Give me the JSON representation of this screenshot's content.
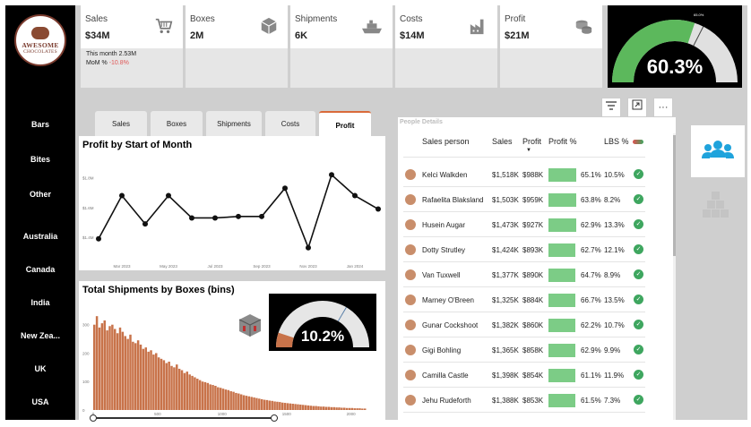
{
  "logo": {
    "line1": "AWESOME",
    "line2": "CHOCOLATES"
  },
  "nav": [
    "Bars",
    "Bites",
    "Other",
    "Australia",
    "Canada",
    "India",
    "New Zea...",
    "UK",
    "USA"
  ],
  "kpis": [
    {
      "label": "Sales",
      "value": "$34M",
      "icon": "cart-icon"
    },
    {
      "label": "Boxes",
      "value": "2M",
      "icon": "box-icon"
    },
    {
      "label": "Shipments",
      "value": "6K",
      "icon": "ship-icon"
    },
    {
      "label": "Costs",
      "value": "$14M",
      "icon": "factory-icon"
    },
    {
      "label": "Profit",
      "value": "$21M",
      "icon": "coins-icon"
    }
  ],
  "kpi_sub": {
    "this_month": "This month 2.53M",
    "mom_label": "MoM %",
    "mom_value": "-10.8%"
  },
  "profit_gauge": {
    "value": 60.3,
    "label": "60.3%",
    "target_label": "65.0%",
    "fill_color": "#5cb85c"
  },
  "tabs": {
    "items": [
      "Sales",
      "Boxes",
      "Shipments",
      "Costs",
      "Profit"
    ],
    "active": "Profit"
  },
  "toolbar": {
    "filter": "filter-icon",
    "expand": "expand-icon",
    "more": "more-icon"
  },
  "line_panel": {
    "title": "Profit by Start of Month"
  },
  "shipments_panel": {
    "title": "Total Shipments by Boxes (bins)"
  },
  "shipments_gauge": {
    "value": 10.2,
    "label": "10.2%",
    "fill_color": "#c8734a"
  },
  "chart_data": [
    {
      "type": "line",
      "title": "Profit by Start of Month",
      "x": [
        "2023-02",
        "2023-03",
        "2023-04",
        "2023-05",
        "2023-06",
        "2023-07",
        "2023-08",
        "2023-09",
        "2023-10",
        "2023-11",
        "2023-12",
        "2024-01",
        "2024-02"
      ],
      "y": [
        1.39,
        1.68,
        1.49,
        1.68,
        1.53,
        1.53,
        1.54,
        1.54,
        1.73,
        1.33,
        1.82,
        1.68,
        1.59
      ],
      "x_tick_labels": [
        "Mar 2023",
        "May 2023",
        "Jul 2023",
        "Sep 2023",
        "Nov 2023",
        "Jan 2024"
      ],
      "y_tick_labels": [
        "$1.4M",
        "$1.6M",
        "$1.8M"
      ],
      "ylim": [
        1.25,
        1.9
      ],
      "unit": "M",
      "grid": false,
      "color": "#111111"
    },
    {
      "type": "bar",
      "title": "Total Shipments by Boxes (bins)",
      "x_tick_labels": [
        "0",
        "500",
        "1000",
        "1500",
        "2000"
      ],
      "y_tick_labels": [
        "0",
        "100",
        "200",
        "300"
      ],
      "xlim": [
        0,
        2100
      ],
      "ylim": [
        0,
        340
      ],
      "bin_width": 20,
      "color": "#c8734a",
      "values": [
        300,
        330,
        290,
        305,
        315,
        280,
        295,
        300,
        285,
        270,
        290,
        275,
        260,
        250,
        265,
        240,
        235,
        245,
        230,
        215,
        220,
        205,
        210,
        195,
        200,
        185,
        180,
        175,
        165,
        170,
        155,
        150,
        160,
        145,
        140,
        130,
        135,
        125,
        120,
        115,
        110,
        105,
        100,
        98,
        95,
        90,
        88,
        85,
        80,
        78,
        75,
        72,
        70,
        66,
        64,
        60,
        58,
        55,
        52,
        50,
        48,
        46,
        44,
        42,
        40,
        38,
        36,
        35,
        33,
        32,
        30,
        29,
        28,
        26,
        25,
        24,
        23,
        22,
        21,
        20,
        19,
        18,
        17,
        16,
        15,
        14,
        14,
        13,
        12,
        12,
        11,
        11,
        10,
        10,
        9,
        9,
        8,
        8,
        7,
        7,
        7,
        6,
        6,
        6,
        5,
        5
      ]
    }
  ],
  "people": {
    "title": "People Details",
    "headers": {
      "name": "Sales person",
      "sales": "Sales",
      "profit": "Profit",
      "profit_pct": "Profit %",
      "lbs": "LBS %"
    },
    "rows": [
      {
        "name": "Kelci Walkden",
        "sales": "$1,518K",
        "profit": "$988K",
        "profit_pct": "65.1%",
        "lbs": "10.5%",
        "bar": 0.98
      },
      {
        "name": "Rafaelita Blaksland",
        "sales": "$1,503K",
        "profit": "$959K",
        "profit_pct": "63.8%",
        "lbs": "8.2%",
        "bar": 0.97
      },
      {
        "name": "Husein Augar",
        "sales": "$1,473K",
        "profit": "$927K",
        "profit_pct": "62.9%",
        "lbs": "13.3%",
        "bar": 0.96
      },
      {
        "name": "Dotty Strutley",
        "sales": "$1,424K",
        "profit": "$893K",
        "profit_pct": "62.7%",
        "lbs": "12.1%",
        "bar": 0.95
      },
      {
        "name": "Van Tuxwell",
        "sales": "$1,377K",
        "profit": "$890K",
        "profit_pct": "64.7%",
        "lbs": "8.9%",
        "bar": 0.95
      },
      {
        "name": "Marney O'Breen",
        "sales": "$1,325K",
        "profit": "$884K",
        "profit_pct": "66.7%",
        "lbs": "13.5%",
        "bar": 0.95
      },
      {
        "name": "Gunar Cockshoot",
        "sales": "$1,382K",
        "profit": "$860K",
        "profit_pct": "62.2%",
        "lbs": "10.7%",
        "bar": 0.94
      },
      {
        "name": "Gigi Bohling",
        "sales": "$1,365K",
        "profit": "$858K",
        "profit_pct": "62.9%",
        "lbs": "9.9%",
        "bar": 0.94
      },
      {
        "name": "Camilla Castle",
        "sales": "$1,398K",
        "profit": "$854K",
        "profit_pct": "61.1%",
        "lbs": "11.9%",
        "bar": 0.94
      },
      {
        "name": "Jehu Rudeforth",
        "sales": "$1,388K",
        "profit": "$853K",
        "profit_pct": "61.5%",
        "lbs": "7.3%",
        "bar": 0.94
      }
    ]
  }
}
